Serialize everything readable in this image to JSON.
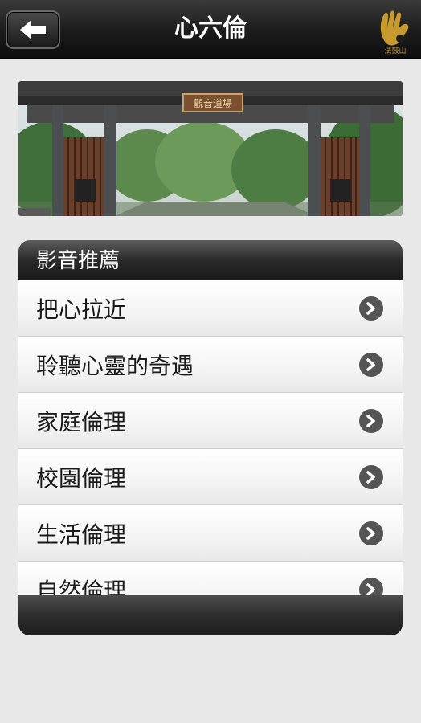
{
  "header": {
    "title": "心六倫",
    "back_icon": "back-arrow-icon",
    "logo_text": "法鼓山"
  },
  "hero": {
    "sign_text": "觀音道場"
  },
  "recommend": {
    "heading": "影音推薦",
    "items": [
      {
        "label": "把心拉近"
      },
      {
        "label": "聆聽心靈的奇遇"
      },
      {
        "label": "家庭倫理"
      },
      {
        "label": "校園倫理"
      },
      {
        "label": "生活倫理"
      },
      {
        "label": "自然倫理"
      }
    ],
    "item_icon": "chevron-right-icon"
  }
}
